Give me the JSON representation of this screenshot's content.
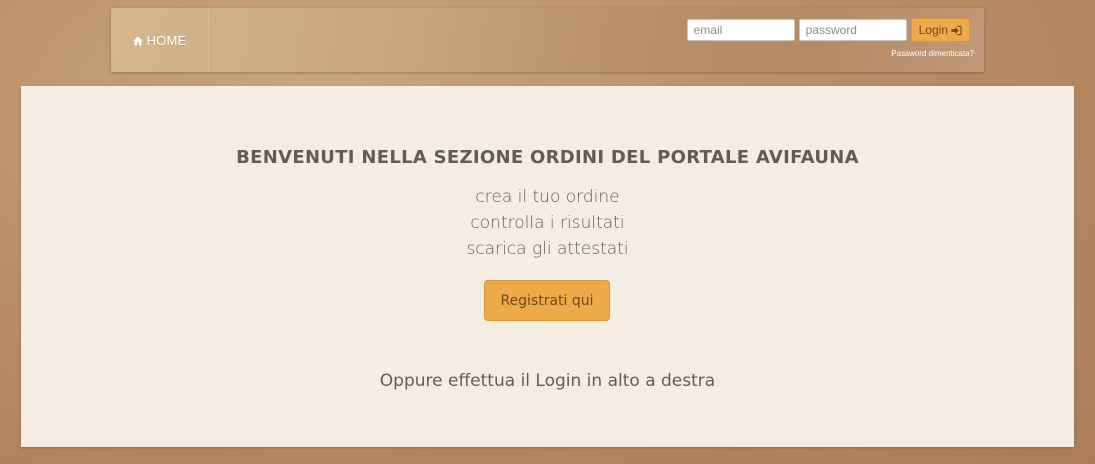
{
  "navbar": {
    "home_label": "HOME",
    "home_icon": "home-icon",
    "email_placeholder": "email",
    "password_placeholder": "password",
    "login_label": "Login",
    "login_icon": "sign-in-icon",
    "forgot_password": "Password dimenticata?"
  },
  "main": {
    "title": "BENVENUTI NELLA SEZIONE ORDINI DEL PORTALE AVIFAUNA",
    "features": [
      "crea il tuo ordine",
      "controlla i risultati",
      "scarica gli attestati"
    ],
    "register_label": "Registrati qui",
    "alt_login_text": "Oppure effettua il Login in alto a destra"
  },
  "colors": {
    "accent": "#eeaa49",
    "panel_background": "#f4ede3",
    "text": "#6b5a53",
    "page_background": "#b98f68"
  }
}
